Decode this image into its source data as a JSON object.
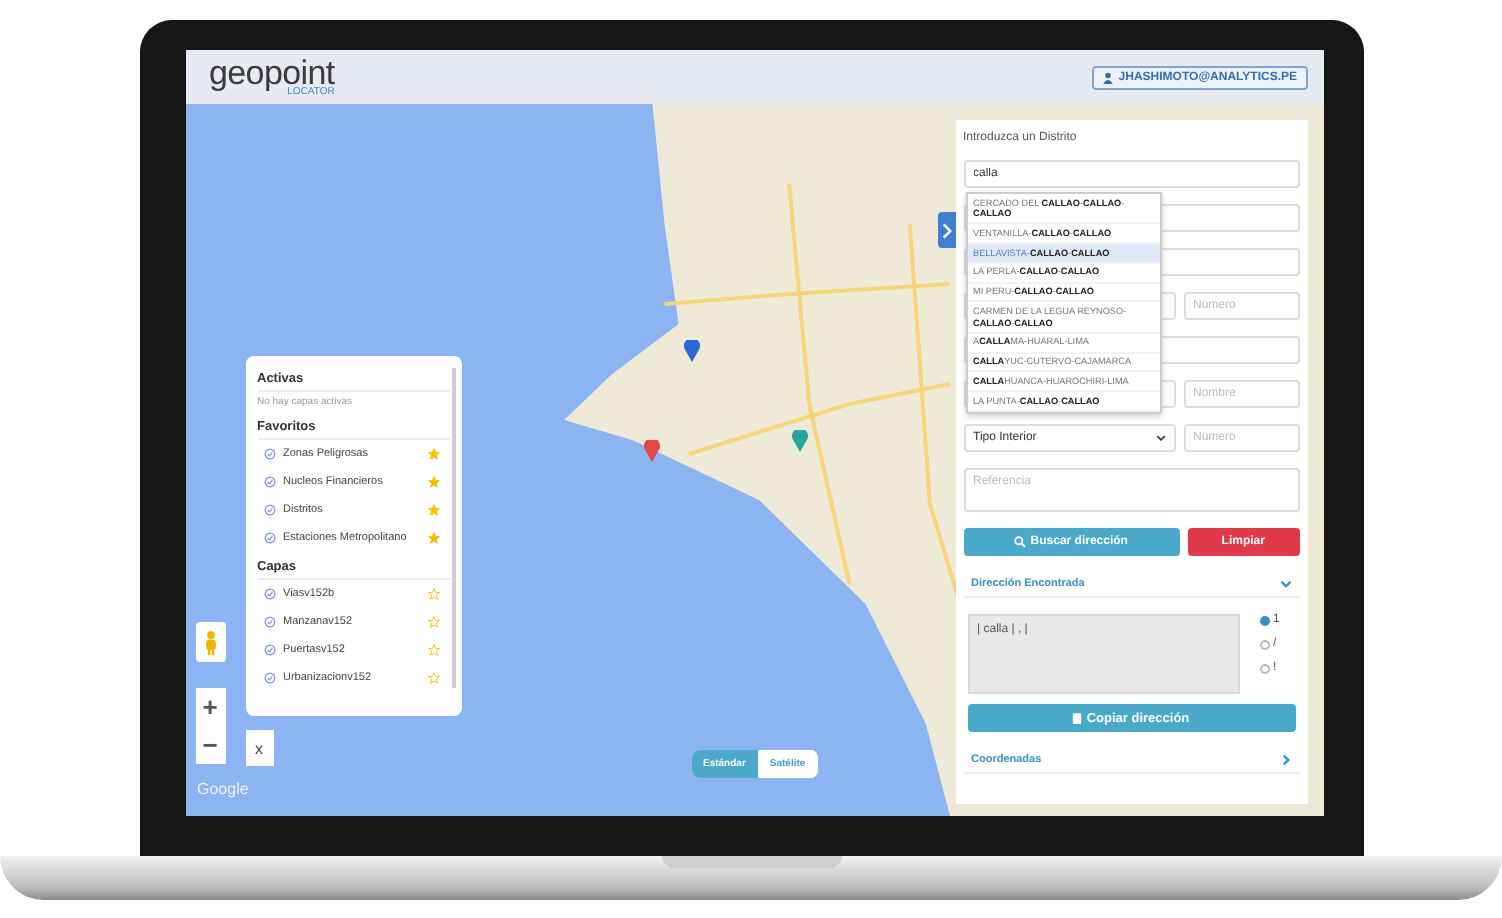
{
  "header": {
    "logo": "geopoint",
    "tagline": "LOCATOR",
    "user": "JHASHIMOTO@ANALYTICS.PE"
  },
  "layers": {
    "sections": [
      {
        "title": "Activas",
        "empty": "No hay capas activas"
      },
      {
        "title": "Favoritos",
        "items": [
          {
            "name": "Zonas Peligrosas",
            "favorite": true
          },
          {
            "name": "Nucleos Financieros",
            "favorite": true
          },
          {
            "name": "Distritos",
            "favorite": true
          },
          {
            "name": "Estaciones Metropolitano",
            "favorite": true
          }
        ]
      },
      {
        "title": "Capas",
        "items": [
          {
            "name": "Viasv152b",
            "favorite": false
          },
          {
            "name": "Manzanav152",
            "favorite": false
          },
          {
            "name": "Puertasv152",
            "favorite": false
          },
          {
            "name": "Urbanizacionv152",
            "favorite": false
          }
        ]
      }
    ]
  },
  "map_controls": {
    "close": "x",
    "zoom_in": "+",
    "zoom_out": "−",
    "attribution": "Google"
  },
  "map_types": [
    {
      "label": "Estándar",
      "selected": true
    },
    {
      "label": "Satélite",
      "selected": false
    }
  ],
  "panel": {
    "label": "Introduzca un Distrito",
    "district": "calla",
    "suggestions": [
      {
        "text": "CERCADO DEL **CALLAO**-**CALLAO**-**CALLAO**",
        "selected": false
      },
      {
        "text": "VENTANILLA-**CALLAO**-**CALLAO**",
        "selected": false
      },
      {
        "text": "BELLAVISTA-**CALLAO**-**CALLAO**",
        "selected": true
      },
      {
        "text": "LA PERLA-**CALLAO**-**CALLAO**",
        "selected": false
      },
      {
        "text": "MI PERU-**CALLAO**-**CALLAO**",
        "selected": false
      },
      {
        "text": "CARMEN DE LA LEGUA REYNOSO-**CALLAO**-**CALLAO**",
        "selected": false
      },
      {
        "text": "A**CALLA**MA-HUARAL-LIMA",
        "selected": false
      },
      {
        "text": "**CALLA**YUC-CUTERVO-CAJAMARCA",
        "selected": false
      },
      {
        "text": "**CALLA**HUANCA-HUAROCHIRI-LIMA",
        "selected": false
      },
      {
        "text": "LA PUNTA-**CALLAO**-**CALLAO**",
        "selected": false
      }
    ],
    "fields": [
      {
        "kind": "full"
      },
      {
        "kind": "full"
      },
      {
        "kind": "pair",
        "placeholders": [
          "Número"
        ]
      },
      {
        "kind": "full"
      },
      {
        "kind": "pair",
        "placeholders": [
          "Nombre"
        ]
      },
      {
        "kind": "select",
        "value": "Tipo Interior",
        "placeholders": [
          "Número"
        ]
      },
      {
        "kind": "area",
        "placeholders": [
          "Referencia"
        ]
      }
    ],
    "search_button": "Buscar dirección",
    "clear_button": "Limpiar",
    "sections": [
      {
        "title": "Dirección Encontrada",
        "expanded": true,
        "result": "| calla | , |",
        "options": [
          {
            "label": "1",
            "selected": true
          },
          {
            "label": "/",
            "selected": false
          },
          {
            "label": "!",
            "selected": false
          }
        ],
        "copy_button": "Copiar dirección"
      },
      {
        "title": "Coordenadas",
        "expanded": false
      }
    ]
  }
}
